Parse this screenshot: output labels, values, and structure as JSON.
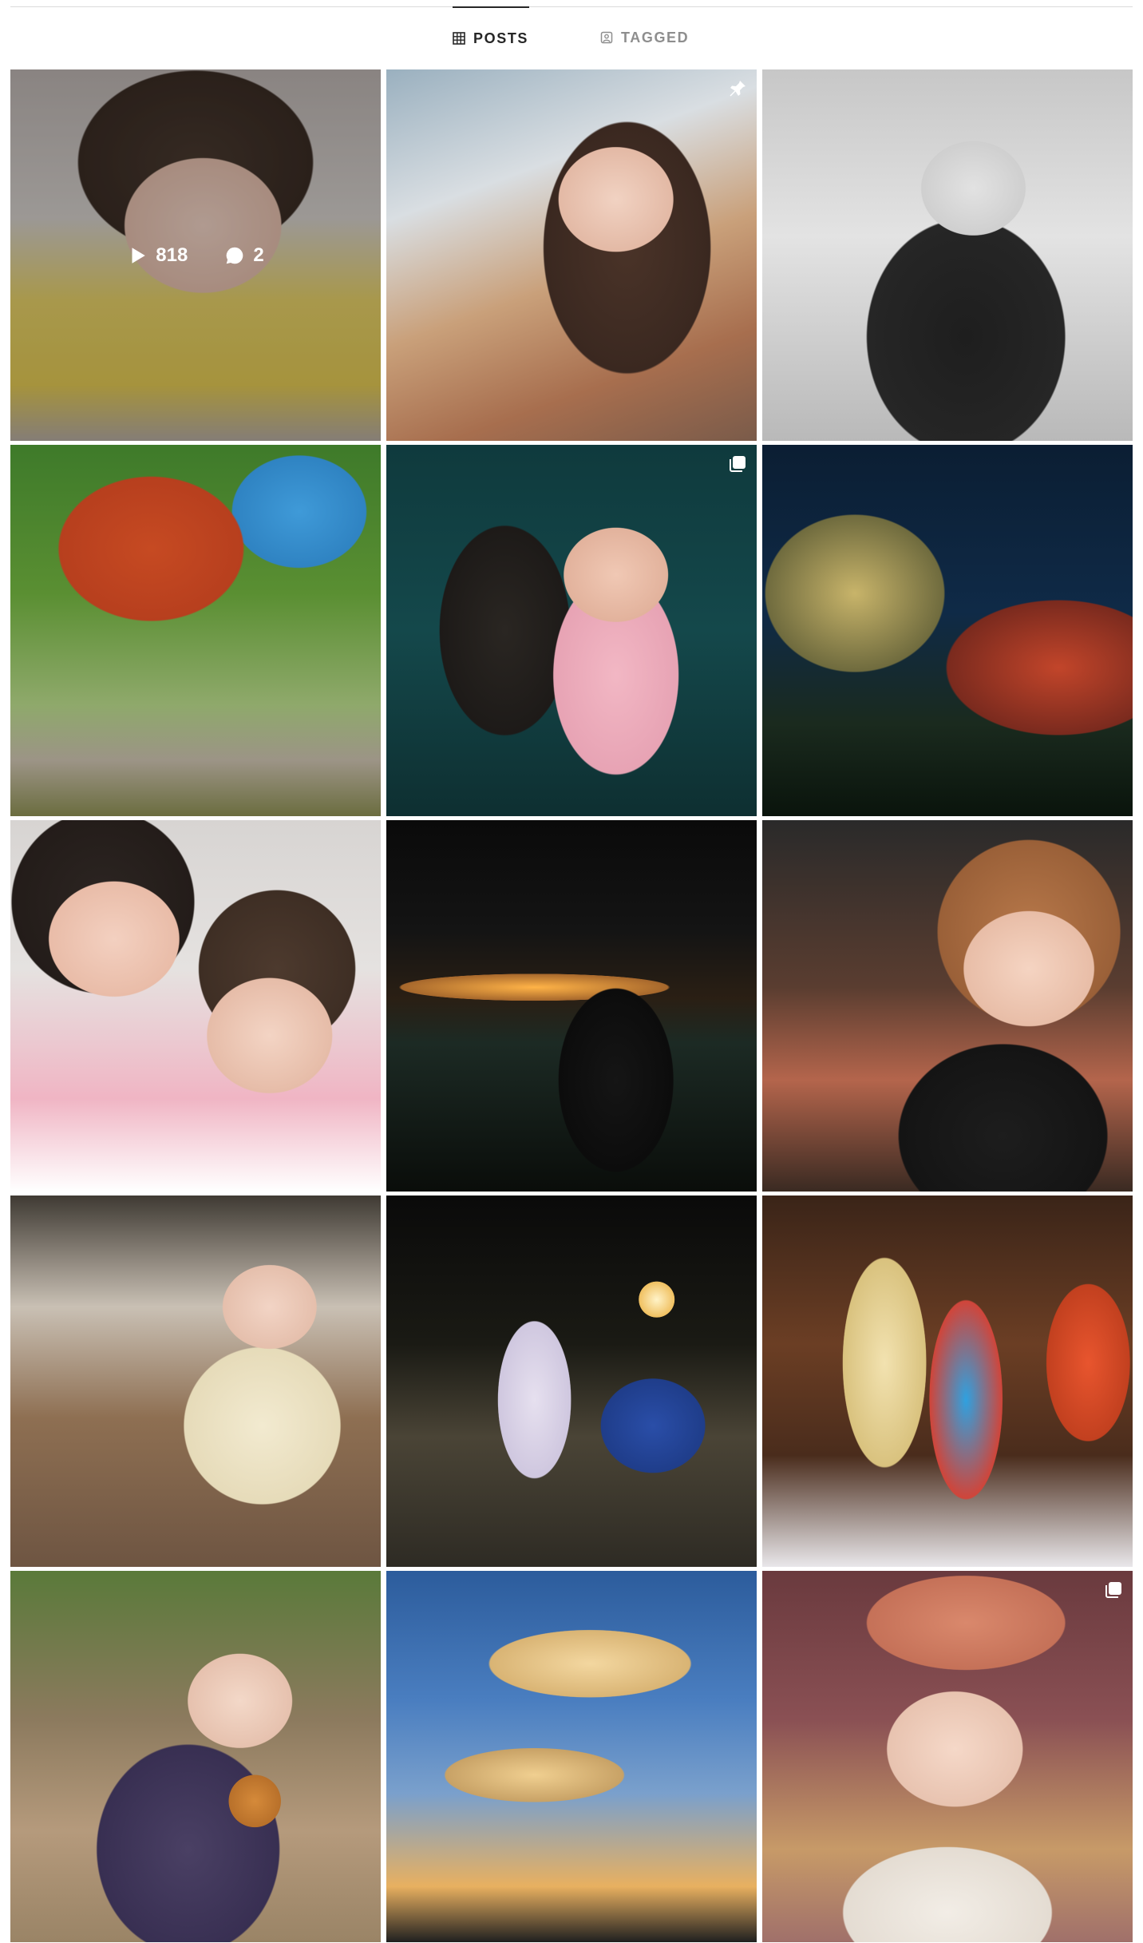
{
  "tabs": [
    {
      "label": "POSTS",
      "icon": "grid-icon",
      "active": true
    },
    {
      "label": "TAGGED",
      "icon": "tagged-user-icon",
      "active": false
    }
  ],
  "grid": {
    "hovered_post": {
      "plays": "818",
      "comments": "2"
    },
    "posts": [
      {
        "badge": "none",
        "hovered": true
      },
      {
        "badge": "pinned-icon"
      },
      {
        "badge": "none"
      },
      {
        "badge": "none"
      },
      {
        "badge": "carousel-icon"
      },
      {
        "badge": "none"
      },
      {
        "badge": "none"
      },
      {
        "badge": "none"
      },
      {
        "badge": "none"
      },
      {
        "badge": "none"
      },
      {
        "badge": "none"
      },
      {
        "badge": "none"
      },
      {
        "badge": "none"
      },
      {
        "badge": "none"
      },
      {
        "badge": "carousel-icon"
      }
    ]
  },
  "colors": {
    "text": "#262626",
    "muted": "#8e8e8e",
    "divider": "#dbdbdb"
  }
}
